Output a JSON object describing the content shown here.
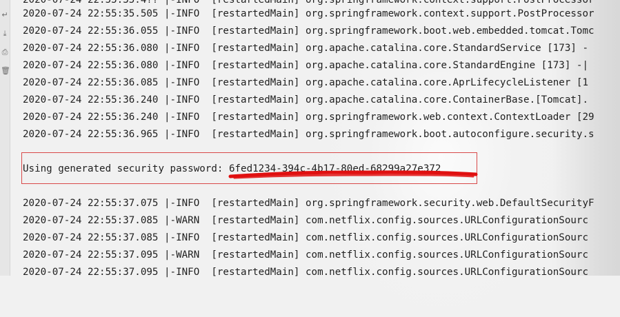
{
  "gutter": {
    "icons": [
      "wrap-icon",
      "scroll-to-end-icon",
      "print-icon",
      "trash-icon"
    ]
  },
  "console": {
    "top_partial": "2020-07-24 22:55:35.4?? |-INFO  [restartedMain] org.springframework.context.support.PostProcessor",
    "lines_before": [
      "2020-07-24 22:55:35.505 |-INFO  [restartedMain] org.springframework.context.support.PostProcessor",
      "2020-07-24 22:55:36.055 |-INFO  [restartedMain] org.springframework.boot.web.embedded.tomcat.Tomc",
      "2020-07-24 22:55:36.080 |-INFO  [restartedMain] org.apache.catalina.core.StandardService [173] -",
      "2020-07-24 22:55:36.080 |-INFO  [restartedMain] org.apache.catalina.core.StandardEngine [173] -|",
      "2020-07-24 22:55:36.085 |-INFO  [restartedMain] org.apache.catalina.core.AprLifecycleListener [1",
      "2020-07-24 22:55:36.240 |-INFO  [restartedMain] org.apache.catalina.core.ContainerBase.[Tomcat].",
      "2020-07-24 22:55:36.240 |-INFO  [restartedMain] org.springframework.web.context.ContextLoader [29",
      "2020-07-24 22:55:36.965 |-INFO  [restartedMain] org.springframework.boot.autoconfigure.security.s"
    ],
    "password_line": "Using generated security password: 6fed1234-394c-4b17-80ed-68299a27e372",
    "lines_after": [
      "2020-07-24 22:55:37.075 |-INFO  [restartedMain] org.springframework.security.web.DefaultSecurityF",
      "2020-07-24 22:55:37.085 |-WARN  [restartedMain] com.netflix.config.sources.URLConfigurationSourc",
      "2020-07-24 22:55:37.085 |-INFO  [restartedMain] com.netflix.config.sources.URLConfigurationSourc",
      "2020-07-24 22:55:37.095 |-WARN  [restartedMain] com.netflix.config.sources.URLConfigurationSourc",
      "2020-07-24 22:55:37.095 |-INFO  [restartedMain] com.netflix.config.sources.URLConfigurationSourc"
    ]
  },
  "colors": {
    "highlight_box": "#d84848",
    "scribble": "#e01010",
    "text": "#1f1f1f"
  }
}
